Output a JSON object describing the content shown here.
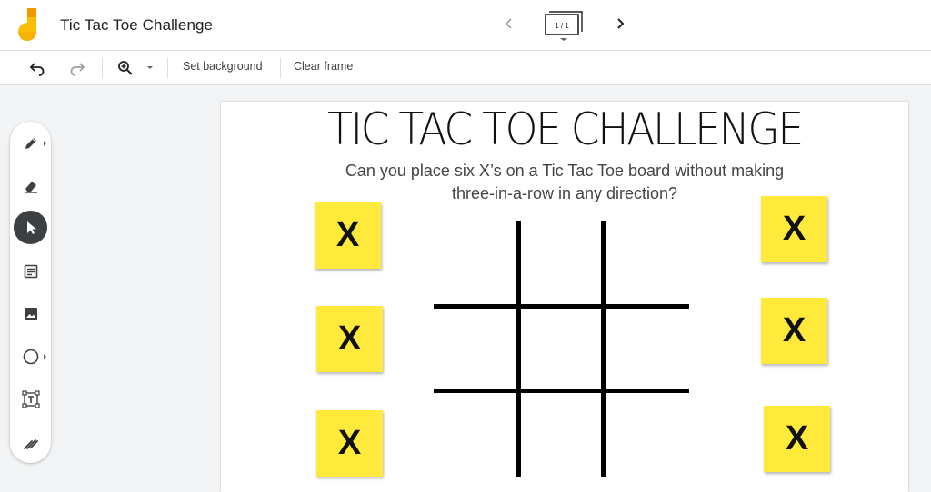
{
  "app": {
    "title": "Tic Tac Toe Challenge",
    "frame_counter": "1 / 1"
  },
  "toolbar": {
    "set_background_label": "Set background",
    "clear_frame_label": "Clear frame"
  },
  "palette": {
    "tools": [
      "pen-icon",
      "eraser-icon",
      "select-icon",
      "sticky-note-icon",
      "image-icon",
      "shape-icon",
      "text-box-icon",
      "laser-icon"
    ],
    "active_tool": "select-icon"
  },
  "canvas": {
    "headline": "TIC TAC TOE CHALLENGE",
    "subtitle": "Can you place six X’s on a Tic Tac Toe board without making three-in-a-row in any direction?",
    "notes": [
      "X",
      "X",
      "X",
      "X",
      "X",
      "X"
    ],
    "note_color": "#ffe93a"
  },
  "colors": {
    "logo_yellow": "#fbbc04",
    "logo_orange": "#f29900",
    "active_tool_bg": "#3c4043"
  }
}
